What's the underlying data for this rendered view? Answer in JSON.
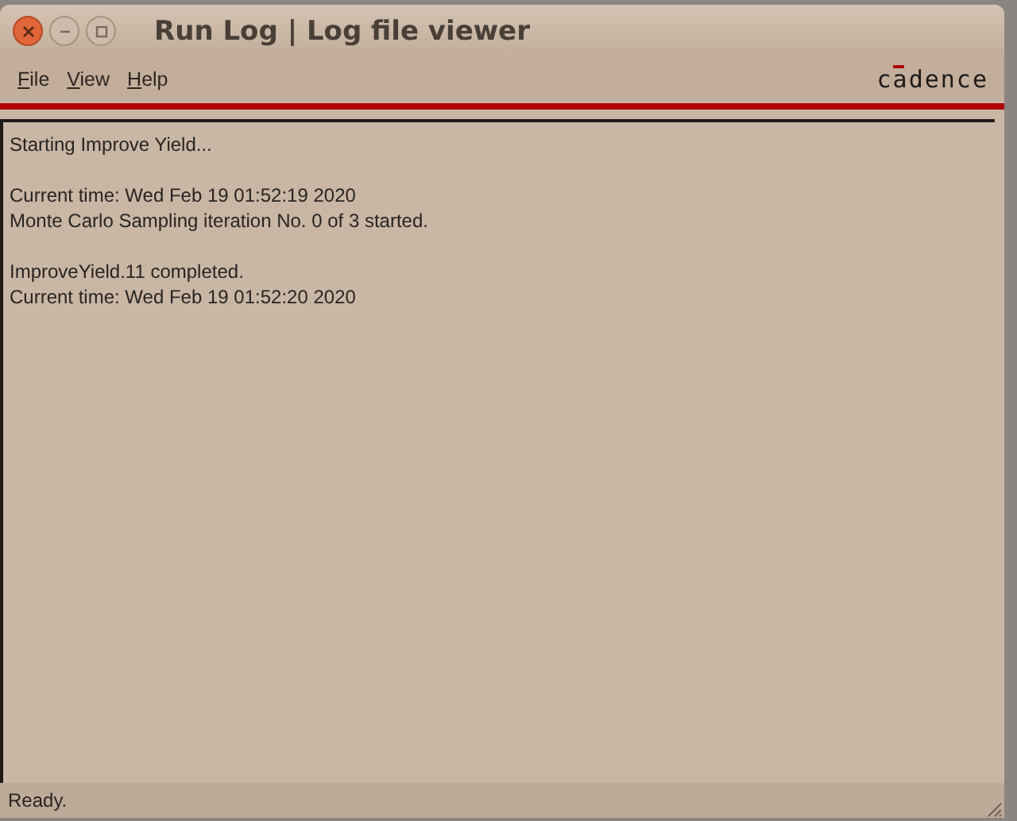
{
  "window": {
    "title": "Run Log | Log file viewer"
  },
  "menu": [
    {
      "label": "File"
    },
    {
      "label": "View"
    },
    {
      "label": "Help"
    }
  ],
  "logo": "cadence",
  "log": {
    "blocks": [
      [
        "Starting Improve Yield..."
      ],
      [
        "Current time: Wed Feb 19 01:52:19 2020",
        "Monte Carlo Sampling iteration No. 0 of 3 started."
      ],
      [
        "ImproveYield.11 completed.",
        "Current time: Wed Feb 19 01:52:20 2020"
      ]
    ]
  },
  "status_bar": "Ready."
}
